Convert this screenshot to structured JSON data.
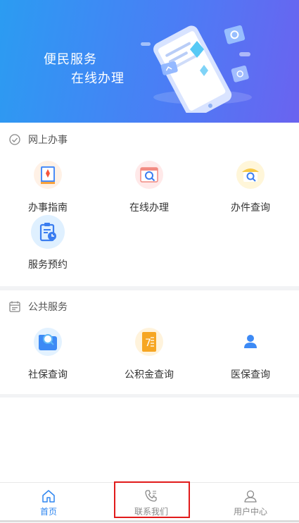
{
  "banner": {
    "line1": "便民服务",
    "line2": "在线办理"
  },
  "sections": [
    {
      "title": "网上办事",
      "icon": "leaf-check-icon",
      "items": [
        {
          "label": "办事指南",
          "icon": "compass-book-icon"
        },
        {
          "label": "在线办理",
          "icon": "browser-search-icon"
        },
        {
          "label": "办件查询",
          "icon": "magnifier-icon"
        },
        {
          "label": "服务预约",
          "icon": "clipboard-clock-icon"
        }
      ]
    },
    {
      "title": "公共服务",
      "icon": "calendar-list-icon",
      "items": [
        {
          "label": "社保查询",
          "icon": "folder-search-icon"
        },
        {
          "label": "公积金查询",
          "icon": "fund-calendar-icon"
        },
        {
          "label": "医保查询",
          "icon": "person-icon"
        }
      ]
    }
  ],
  "tabbar": {
    "tabs": [
      {
        "label": "首页",
        "icon": "home-icon",
        "active": true
      },
      {
        "label": "联系我们",
        "icon": "phone-icon",
        "active": false
      },
      {
        "label": "用户中心",
        "icon": "user-icon",
        "active": false
      }
    ]
  },
  "colors": {
    "accent": "#2e86f0",
    "highlight": "#e11b1b",
    "banner_start": "#2b9cf2",
    "banner_end": "#6a63f0"
  }
}
